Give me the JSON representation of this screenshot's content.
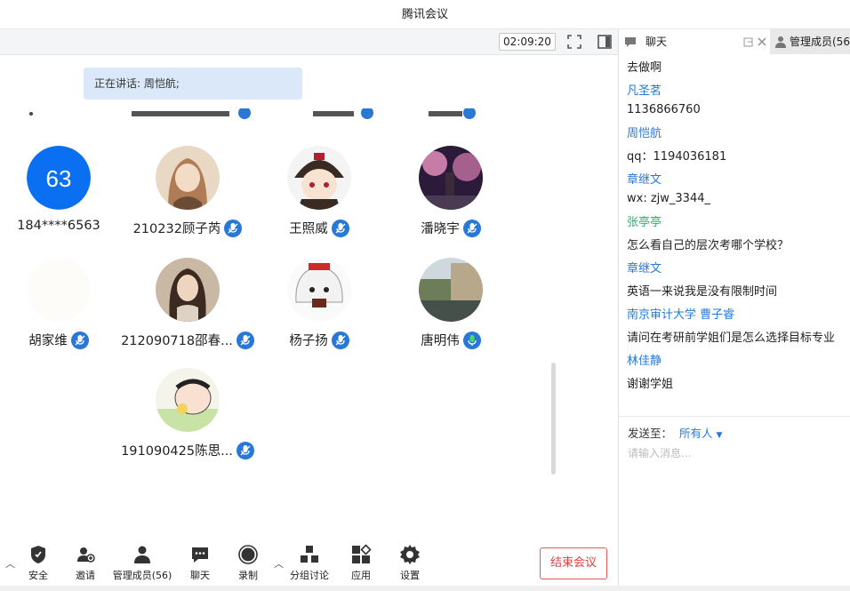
{
  "window": {
    "title": "腾讯会议"
  },
  "toolbar": {
    "timer": "02:09:20"
  },
  "main": {
    "speaking_label": "正在讲话: 周恺航;",
    "participants": [
      {
        "name": "184****6563",
        "avatar_text": "63",
        "avatar_color": "#0b6ff2",
        "mic": false
      },
      {
        "name": "210232顾子芮",
        "mic": true
      },
      {
        "name": "王照威",
        "mic": true
      },
      {
        "name": "潘晓宇",
        "mic": true
      },
      {
        "name": "胡家维",
        "mic": true
      },
      {
        "name": "212090718邵春...",
        "mic": true
      },
      {
        "name": "杨子扬",
        "mic": true
      },
      {
        "name": "唐明伟",
        "mic": true,
        "mic_active": true
      },
      {
        "name": "191090425陈思...",
        "mic": true
      }
    ]
  },
  "bottombar": {
    "security": "安全",
    "invite": "邀请",
    "members": "管理成员(56)",
    "chat": "聊天",
    "record": "录制",
    "breakout": "分组讨论",
    "apps": "应用",
    "settings": "设置",
    "end_meeting": "结束会议"
  },
  "sidebar": {
    "tab_chat": "聊天",
    "tab_members": "管理成员(56",
    "messages": [
      {
        "kind": "text",
        "text": "去做啊"
      },
      {
        "kind": "sender",
        "text": "凡圣茗"
      },
      {
        "kind": "text",
        "text": "1136866760"
      },
      {
        "kind": "sender",
        "text": "周恺航"
      },
      {
        "kind": "text",
        "text": "qq：1194036181"
      },
      {
        "kind": "sender",
        "text": "章继文"
      },
      {
        "kind": "text",
        "text": "wx: zjw_3344_"
      },
      {
        "kind": "sender-green",
        "text": "张亭亭"
      },
      {
        "kind": "text",
        "text": "怎么看自己的层次考哪个学校？"
      },
      {
        "kind": "sender",
        "text": "章继文"
      },
      {
        "kind": "text",
        "text": "英语一来说我是没有限制时间"
      },
      {
        "kind": "sender",
        "text": "南京审计大学 曹子睿"
      },
      {
        "kind": "text",
        "text": "请问在考研前学姐们是怎么选择目标专业"
      },
      {
        "kind": "sender",
        "text": "林佳静"
      },
      {
        "kind": "text",
        "text": "谢谢学姐"
      }
    ],
    "send_to_label": "发送至：",
    "send_target": "所有人",
    "input_placeholder": "请输入消息..."
  },
  "colors": {
    "accent": "#2878d8",
    "end_button": "#e04040",
    "speaking_bg": "#dbe8f9"
  }
}
